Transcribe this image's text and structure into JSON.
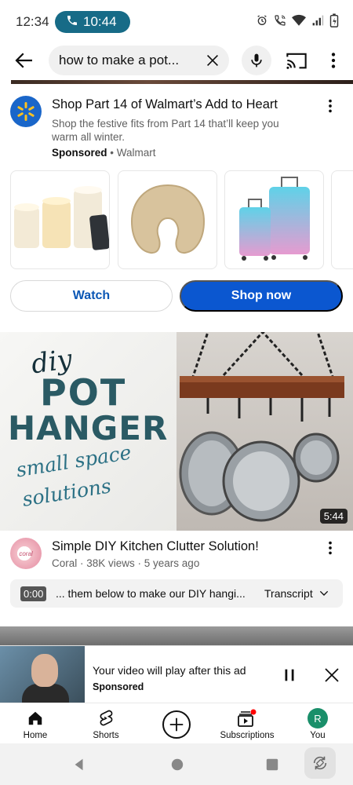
{
  "status_bar": {
    "time": "12:34",
    "call_timer": "10:44",
    "icons": [
      "phone-icon",
      "alarm-icon",
      "wifi-call-icon",
      "wifi-icon",
      "signal-icon",
      "battery-icon"
    ]
  },
  "search": {
    "query": "how to make a pot...",
    "icons": [
      "back-arrow-icon",
      "clear-icon",
      "mic-icon",
      "cast-icon",
      "more-vert-icon"
    ]
  },
  "ad": {
    "title": "Shop Part 14 of Walmart’s Add to Heart",
    "description": "Shop the festive fits from Part 14 that’ll keep you warm all winter.",
    "sponsored_label": "Sponsored",
    "separator": "•",
    "advertiser": "Walmart",
    "products": [
      "led-candles-image",
      "neck-pillow-image",
      "luggage-set-image"
    ],
    "watch_label": "Watch",
    "shop_label": "Shop now",
    "brand_color": "#0b57d0"
  },
  "video": {
    "thumb_text": {
      "diy": "diy",
      "pot": "POT",
      "hanger": "HANGER",
      "line1": "small space",
      "line2": "solutions"
    },
    "duration": "5:44",
    "channel_avatar_text": "coral",
    "title": "Simple DIY Kitchen Clutter Solution!",
    "meta": "Coral · 38K views · 5 years ago"
  },
  "transcript": {
    "timestamp": "0:00",
    "snippet": "... them below to make our DIY hangi...",
    "label": "Transcript"
  },
  "mini_player": {
    "title": "Your video will play after this ad",
    "subtitle": "Sponsored"
  },
  "bottom_nav": {
    "home": "Home",
    "shorts": "Shorts",
    "subscriptions": "Subscriptions",
    "you": "You",
    "you_initial": "R",
    "notification_color": "#ff0000"
  }
}
